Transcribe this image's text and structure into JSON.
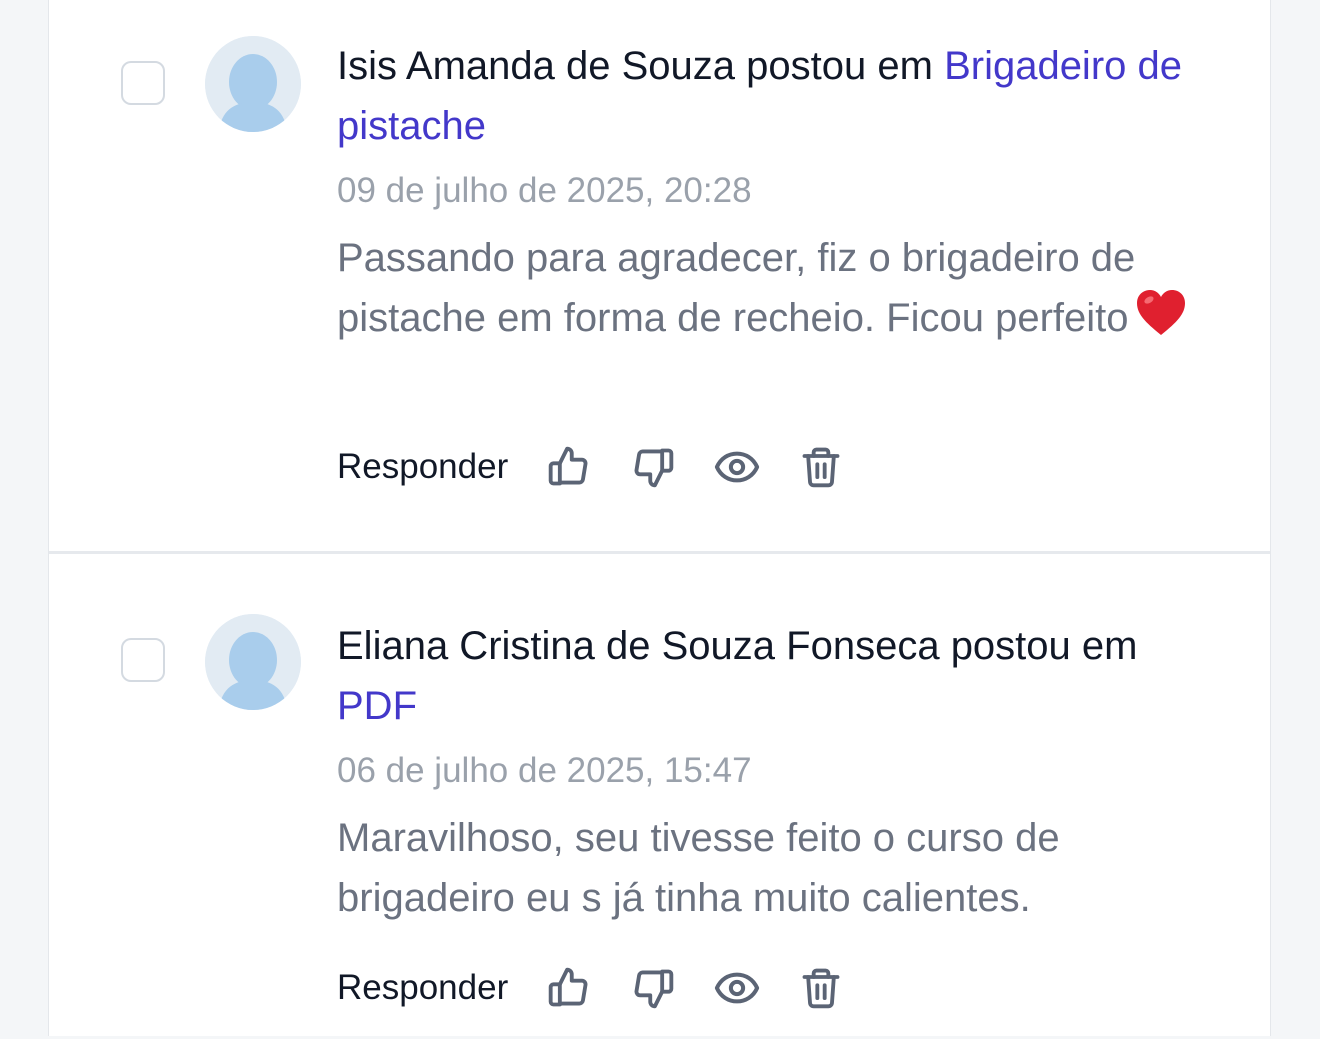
{
  "comments": [
    {
      "author": "Isis Amanda de Souza",
      "posted_in_text": "postou em",
      "post_link": "Brigadeiro de pistache",
      "date": "09 de julho de 2025, 20:28",
      "body": "Passando para agradecer, fiz o brigadeiro de pistache em forma de recheio. Ficou perfeito",
      "emoji": "heart-emoji",
      "reply_label": "Responder"
    },
    {
      "author": "Eliana Cristina de Souza Fonseca",
      "posted_in_text": "postou em",
      "post_link": "PDF",
      "date": "06 de julho de 2025, 15:47",
      "body": "Maravilhoso, seu tivesse feito o curso de brigadeiro eu s já tinha muito calientes.",
      "reply_label": "Responder"
    }
  ],
  "icons": {
    "like": "thumbs-up-icon",
    "dislike": "thumbs-down-icon",
    "view": "eye-icon",
    "delete": "trash-icon"
  },
  "colors": {
    "link": "#4338ca",
    "text_primary": "#111827",
    "text_secondary": "#6b7280",
    "text_muted": "#9aa1ab",
    "emoji_heart": "#e0202f"
  }
}
